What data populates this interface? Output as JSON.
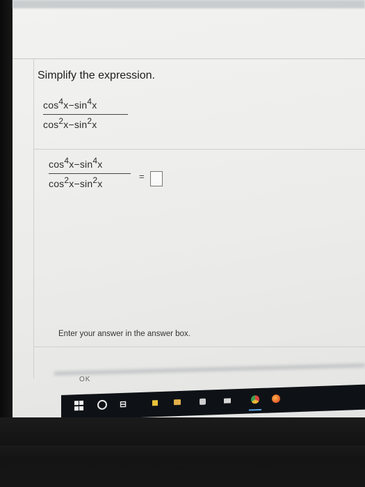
{
  "question": {
    "title": "Simplify the expression."
  },
  "expression": {
    "numerator_term1": "cos",
    "numerator_exp1": "4",
    "numerator_var1": "x",
    "numerator_op": " − ",
    "numerator_term2": "sin",
    "numerator_exp2": "4",
    "numerator_var2": "x",
    "denominator_term1": "cos",
    "denominator_exp1": "2",
    "denominator_var1": "x",
    "denominator_op": " − ",
    "denominator_term2": "sin",
    "denominator_exp2": "2",
    "denominator_var2": "x"
  },
  "answer_row": {
    "equals": "=",
    "answer_value": ""
  },
  "instruction": "Enter your answer in the answer box.",
  "footer": {
    "ok_label": "OK"
  },
  "taskbar": {
    "items": [
      {
        "name": "windows-start-icon"
      },
      {
        "name": "search-icon"
      },
      {
        "name": "task-view-icon"
      },
      {
        "name": "yellow-app-icon"
      },
      {
        "name": "file-explorer-icon"
      },
      {
        "name": "store-icon"
      },
      {
        "name": "mail-icon"
      },
      {
        "name": "chrome-icon"
      },
      {
        "name": "firefox-icon"
      }
    ],
    "taskview_glyph": "⊟"
  }
}
